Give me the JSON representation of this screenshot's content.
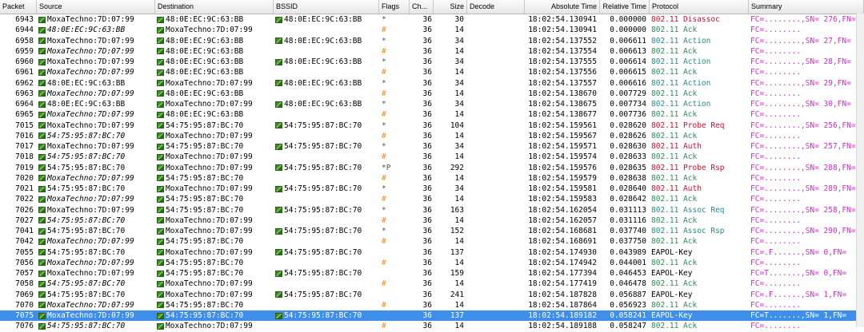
{
  "columns": {
    "packet": "Packet",
    "source": "Source",
    "destination": "Destination",
    "bssid": "BSSID",
    "flags": "Flags",
    "channel": "Ch...",
    "size": "Size",
    "decode": "Decode",
    "abs_time": "Absolute Time",
    "rel_time": "Relative Time",
    "protocol": "Protocol",
    "summary": "Summary"
  },
  "colors": {
    "selected_row": "#3f8ee8",
    "flag_hash": "#f08a1c",
    "summary": "#d02cc8",
    "protocol_red": "#c8102e",
    "protocol_green": "#2e8b57"
  },
  "rows": [
    {
      "packet": "6943",
      "src": "MoxaTechno:7D:07:99",
      "src_i": false,
      "src_icon": true,
      "dst": "48:0E:EC:9C:63:BB",
      "dst_icon": true,
      "bssid": "48:0E:EC:9C:63:BB",
      "bssid_icon": true,
      "flags": "*",
      "ch": "36",
      "size": "30",
      "abs": "18:02:54.130941",
      "rel": "0.000000",
      "proto": "802.11 Disassoc",
      "proto_c": "red",
      "sum": "FC=........,SN= 276,FN="
    },
    {
      "packet": "6944",
      "src": "48:0E:EC:9C:63:BB",
      "src_i": true,
      "src_icon": true,
      "dst": "MoxaTechno:7D:07:99",
      "dst_icon": true,
      "bssid": "",
      "bssid_icon": false,
      "flags": "#",
      "ch": "36",
      "size": "14",
      "abs": "18:02:54.130941",
      "rel": "0.000000",
      "proto": "802.11 Ack",
      "proto_c": "green",
      "sum": "FC=........"
    },
    {
      "packet": "6958",
      "src": "MoxaTechno:7D:07:99",
      "src_i": false,
      "src_icon": true,
      "dst": "48:0E:EC:9C:63:BB",
      "dst_icon": true,
      "bssid": "48:0E:EC:9C:63:BB",
      "bssid_icon": true,
      "flags": "*",
      "ch": "36",
      "size": "34",
      "abs": "18:02:54.137552",
      "rel": "0.006611",
      "proto": "802.11 Action",
      "proto_c": "teal",
      "sum": "FC=........,SN=  27,FN="
    },
    {
      "packet": "6959",
      "src": "MoxaTechno:7D:07:99",
      "src_i": true,
      "src_icon": true,
      "dst": "48:0E:EC:9C:63:BB",
      "dst_icon": true,
      "bssid": "",
      "bssid_icon": false,
      "flags": "#",
      "ch": "36",
      "size": "14",
      "abs": "18:02:54.137554",
      "rel": "0.006613",
      "proto": "802.11 Ack",
      "proto_c": "green",
      "sum": "FC=........"
    },
    {
      "packet": "6960",
      "src": "MoxaTechno:7D:07:99",
      "src_i": false,
      "src_icon": true,
      "dst": "48:0E:EC:9C:63:BB",
      "dst_icon": true,
      "bssid": "48:0E:EC:9C:63:BB",
      "bssid_icon": true,
      "flags": "*",
      "ch": "36",
      "size": "34",
      "abs": "18:02:54.137555",
      "rel": "0.006614",
      "proto": "802.11 Action",
      "proto_c": "teal",
      "sum": "FC=........,SN=  28,FN="
    },
    {
      "packet": "6961",
      "src": "MoxaTechno:7D:07:99",
      "src_i": true,
      "src_icon": true,
      "dst": "48:0E:EC:9C:63:BB",
      "dst_icon": true,
      "bssid": "",
      "bssid_icon": false,
      "flags": "#",
      "ch": "36",
      "size": "14",
      "abs": "18:02:54.137556",
      "rel": "0.006615",
      "proto": "802.11 Ack",
      "proto_c": "green",
      "sum": "FC=........"
    },
    {
      "packet": "6962",
      "src": "48:0E:EC:9C:63:BB",
      "src_i": false,
      "src_icon": true,
      "dst": "MoxaTechno:7D:07:99",
      "dst_icon": true,
      "bssid": "48:0E:EC:9C:63:BB",
      "bssid_icon": true,
      "flags": "*",
      "ch": "36",
      "size": "34",
      "abs": "18:02:54.137557",
      "rel": "0.006616",
      "proto": "802.11 Action",
      "proto_c": "teal",
      "sum": "FC=........,SN=  29,FN="
    },
    {
      "packet": "6963",
      "src": "MoxaTechno:7D:07:99",
      "src_i": true,
      "src_icon": true,
      "dst": "48:0E:EC:9C:63:BB",
      "dst_icon": true,
      "bssid": "",
      "bssid_icon": false,
      "flags": "#",
      "ch": "36",
      "size": "14",
      "abs": "18:02:54.138670",
      "rel": "0.007729",
      "proto": "802.11 Ack",
      "proto_c": "green",
      "sum": "FC=........"
    },
    {
      "packet": "6964",
      "src": "48:0E:EC:9C:63:BB",
      "src_i": false,
      "src_icon": true,
      "dst": "MoxaTechno:7D:07:99",
      "dst_icon": true,
      "bssid": "48:0E:EC:9C:63:BB",
      "bssid_icon": true,
      "flags": "*",
      "ch": "36",
      "size": "34",
      "abs": "18:02:54.138675",
      "rel": "0.007734",
      "proto": "802.11 Action",
      "proto_c": "teal",
      "sum": "FC=........,SN=  30,FN="
    },
    {
      "packet": "6965",
      "src": "MoxaTechno:7D:07:99",
      "src_i": true,
      "src_icon": true,
      "dst": "48:0E:EC:9C:63:BB",
      "dst_icon": true,
      "bssid": "",
      "bssid_icon": false,
      "flags": "#",
      "ch": "36",
      "size": "14",
      "abs": "18:02:54.138677",
      "rel": "0.007736",
      "proto": "802.11 Ack",
      "proto_c": "green",
      "sum": "FC=........"
    },
    {
      "packet": "7015",
      "src": "MoxaTechno:7D:07:99",
      "src_i": false,
      "src_icon": true,
      "dst": "54:75:95:87:BC:70",
      "dst_icon": true,
      "bssid": "54:75:95:87:BC:70",
      "bssid_icon": true,
      "flags": "*",
      "ch": "36",
      "size": "104",
      "abs": "18:02:54.159561",
      "rel": "0.028620",
      "proto": "802.11 Probe Req",
      "proto_c": "red",
      "sum": "FC=........,SN= 256,FN="
    },
    {
      "packet": "7016",
      "src": "54:75:95:87:BC:70",
      "src_i": true,
      "src_icon": true,
      "dst": "MoxaTechno:7D:07:99",
      "dst_icon": true,
      "bssid": "",
      "bssid_icon": false,
      "flags": "#",
      "ch": "36",
      "size": "14",
      "abs": "18:02:54.159567",
      "rel": "0.028626",
      "proto": "802.11 Ack",
      "proto_c": "green",
      "sum": "FC=........"
    },
    {
      "packet": "7017",
      "src": "MoxaTechno:7D:07:99",
      "src_i": false,
      "src_icon": true,
      "dst": "54:75:95:87:BC:70",
      "dst_icon": true,
      "bssid": "54:75:95:87:BC:70",
      "bssid_icon": true,
      "flags": "*",
      "ch": "36",
      "size": "34",
      "abs": "18:02:54.159571",
      "rel": "0.028630",
      "proto": "802.11 Auth",
      "proto_c": "red",
      "sum": "FC=........,SN= 257,FN="
    },
    {
      "packet": "7018",
      "src": "54:75:95:87:BC:70",
      "src_i": true,
      "src_icon": true,
      "dst": "MoxaTechno:7D:07:99",
      "dst_icon": true,
      "bssid": "",
      "bssid_icon": false,
      "flags": "#",
      "ch": "36",
      "size": "14",
      "abs": "18:02:54.159574",
      "rel": "0.028633",
      "proto": "802.11 Ack",
      "proto_c": "green",
      "sum": "FC=........"
    },
    {
      "packet": "7019",
      "src": "54:75:95:87:BC:70",
      "src_i": false,
      "src_icon": true,
      "dst": "MoxaTechno:7D:07:99",
      "dst_icon": true,
      "bssid": "54:75:95:87:BC:70",
      "bssid_icon": true,
      "flags": "*P",
      "ch": "36",
      "size": "292",
      "abs": "18:02:54.159576",
      "rel": "0.028635",
      "proto": "802.11 Probe Rsp",
      "proto_c": "red",
      "sum": "FC=........,SN= 288,FN="
    },
    {
      "packet": "7020",
      "src": "MoxaTechno:7D:07:99",
      "src_i": true,
      "src_icon": true,
      "dst": "54:75:95:87:BC:70",
      "dst_icon": true,
      "bssid": "",
      "bssid_icon": false,
      "flags": "#",
      "ch": "36",
      "size": "14",
      "abs": "18:02:54.159579",
      "rel": "0.028638",
      "proto": "802.11 Ack",
      "proto_c": "green",
      "sum": "FC=........"
    },
    {
      "packet": "7021",
      "src": "54:75:95:87:BC:70",
      "src_i": false,
      "src_icon": true,
      "dst": "MoxaTechno:7D:07:99",
      "dst_icon": true,
      "bssid": "54:75:95:87:BC:70",
      "bssid_icon": true,
      "flags": "*",
      "ch": "36",
      "size": "34",
      "abs": "18:02:54.159581",
      "rel": "0.028640",
      "proto": "802.11 Auth",
      "proto_c": "red",
      "sum": "FC=........,SN= 289,FN="
    },
    {
      "packet": "7022",
      "src": "MoxaTechno:7D:07:99",
      "src_i": true,
      "src_icon": true,
      "dst": "54:75:95:87:BC:70",
      "dst_icon": true,
      "bssid": "",
      "bssid_icon": false,
      "flags": "#",
      "ch": "36",
      "size": "14",
      "abs": "18:02:54.159583",
      "rel": "0.028642",
      "proto": "802.11 Ack",
      "proto_c": "green",
      "sum": "FC=........"
    },
    {
      "packet": "7026",
      "src": "MoxaTechno:7D:07:99",
      "src_i": false,
      "src_icon": true,
      "dst": "54:75:95:87:BC:70",
      "dst_icon": true,
      "bssid": "54:75:95:87:BC:70",
      "bssid_icon": true,
      "flags": "*",
      "ch": "36",
      "size": "163",
      "abs": "18:02:54.162054",
      "rel": "0.031113",
      "proto": "802.11 Assoc Req",
      "proto_c": "teal",
      "sum": "FC=........,SN= 258,FN="
    },
    {
      "packet": "7027",
      "src": "54:75:95:87:BC:70",
      "src_i": true,
      "src_icon": true,
      "dst": "MoxaTechno:7D:07:99",
      "dst_icon": true,
      "bssid": "",
      "bssid_icon": false,
      "flags": "#",
      "ch": "36",
      "size": "14",
      "abs": "18:02:54.162057",
      "rel": "0.031116",
      "proto": "802.11 Ack",
      "proto_c": "green",
      "sum": "FC=........"
    },
    {
      "packet": "7041",
      "src": "54:75:95:87:BC:70",
      "src_i": false,
      "src_icon": true,
      "dst": "MoxaTechno:7D:07:99",
      "dst_icon": true,
      "bssid": "54:75:95:87:BC:70",
      "bssid_icon": true,
      "flags": "*",
      "ch": "36",
      "size": "152",
      "abs": "18:02:54.168681",
      "rel": "0.037740",
      "proto": "802.11 Assoc Rsp",
      "proto_c": "teal",
      "sum": "FC=........,SN= 290,FN="
    },
    {
      "packet": "7042",
      "src": "MoxaTechno:7D:07:99",
      "src_i": true,
      "src_icon": true,
      "dst": "54:75:95:87:BC:70",
      "dst_icon": true,
      "bssid": "",
      "bssid_icon": false,
      "flags": "#",
      "ch": "36",
      "size": "14",
      "abs": "18:02:54.168691",
      "rel": "0.037750",
      "proto": "802.11 Ack",
      "proto_c": "green",
      "sum": "FC=........"
    },
    {
      "packet": "7055",
      "src": "54:75:95:87:BC:70",
      "src_i": false,
      "src_icon": true,
      "dst": "MoxaTechno:7D:07:99",
      "dst_icon": true,
      "bssid": "54:75:95:87:BC:70",
      "bssid_icon": true,
      "flags": "",
      "ch": "36",
      "size": "137",
      "abs": "18:02:54.174930",
      "rel": "0.043989",
      "proto": "EAPOL-Key",
      "proto_c": "plain",
      "sum": "FC=.F......,SN=   0,FN="
    },
    {
      "packet": "7056",
      "src": "MoxaTechno:7D:07:99",
      "src_i": true,
      "src_icon": true,
      "dst": "54:75:95:87:BC:70",
      "dst_icon": true,
      "bssid": "",
      "bssid_icon": false,
      "flags": "#",
      "ch": "36",
      "size": "14",
      "abs": "18:02:54.174942",
      "rel": "0.044001",
      "proto": "802.11 Ack",
      "proto_c": "green",
      "sum": "FC=........"
    },
    {
      "packet": "7057",
      "src": "MoxaTechno:7D:07:99",
      "src_i": false,
      "src_icon": true,
      "dst": "54:75:95:87:BC:70",
      "dst_icon": true,
      "bssid": "54:75:95:87:BC:70",
      "bssid_icon": true,
      "flags": "",
      "ch": "36",
      "size": "159",
      "abs": "18:02:54.177394",
      "rel": "0.046453",
      "proto": "EAPOL-Key",
      "proto_c": "plain",
      "sum": "FC=T.......,SN=   0,FN="
    },
    {
      "packet": "7058",
      "src": "54:75:95:87:BC:70",
      "src_i": true,
      "src_icon": true,
      "dst": "MoxaTechno:7D:07:99",
      "dst_icon": true,
      "bssid": "",
      "bssid_icon": false,
      "flags": "#",
      "ch": "36",
      "size": "14",
      "abs": "18:02:54.177419",
      "rel": "0.046478",
      "proto": "802.11 Ack",
      "proto_c": "green",
      "sum": "FC=........"
    },
    {
      "packet": "7069",
      "src": "54:75:95:87:BC:70",
      "src_i": false,
      "src_icon": true,
      "dst": "MoxaTechno:7D:07:99",
      "dst_icon": true,
      "bssid": "54:75:95:87:BC:70",
      "bssid_icon": true,
      "flags": "",
      "ch": "36",
      "size": "241",
      "abs": "18:02:54.187828",
      "rel": "0.056887",
      "proto": "EAPOL-Key",
      "proto_c": "plain",
      "sum": "FC=.F......,SN=   1,FN="
    },
    {
      "packet": "7070",
      "src": "MoxaTechno:7D:07:99",
      "src_i": true,
      "src_icon": true,
      "dst": "54:75:95:87:BC:70",
      "dst_icon": true,
      "bssid": "",
      "bssid_icon": false,
      "flags": "#",
      "ch": "36",
      "size": "14",
      "abs": "18:02:54.187864",
      "rel": "0.056923",
      "proto": "802.11 Ack",
      "proto_c": "green",
      "sum": "FC=........"
    },
    {
      "packet": "7075",
      "src": "MoxaTechno:7D:07:99",
      "src_i": false,
      "src_icon": true,
      "dst": "54:75:95:87:BC:70",
      "dst_icon": true,
      "bssid": "54:75:95:87:BC:70",
      "bssid_icon": true,
      "flags": "",
      "ch": "36",
      "size": "137",
      "abs": "18:02:54.189182",
      "rel": "0.058241",
      "proto": "EAPOL-Key",
      "proto_c": "plain",
      "sum": "FC=T.......,SN=   1,FN=",
      "selected": true
    },
    {
      "packet": "7076",
      "src": "54:75:95:87:BC:70",
      "src_i": true,
      "src_icon": true,
      "dst": "MoxaTechno:7D:07:99",
      "dst_icon": true,
      "bssid": "",
      "bssid_icon": false,
      "flags": "#",
      "ch": "36",
      "size": "14",
      "abs": "18:02:54.189188",
      "rel": "0.058247",
      "proto": "802.11 Ack",
      "proto_c": "green",
      "sum": "FC=........"
    }
  ]
}
